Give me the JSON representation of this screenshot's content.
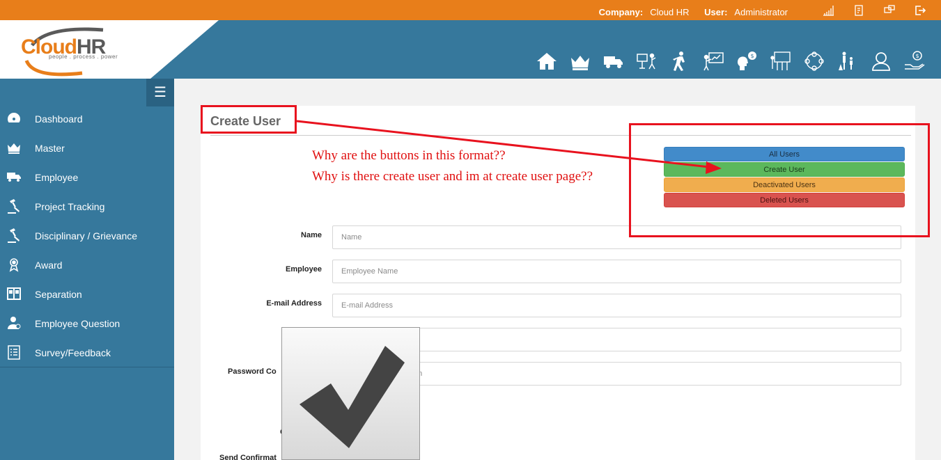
{
  "topbar": {
    "company_label": "Company:",
    "company_value": "Cloud HR",
    "user_label": "User:",
    "user_value": "Administrator",
    "icons": [
      "bar-chart-icon",
      "clipboard-icon",
      "message-icon",
      "logout-icon"
    ]
  },
  "logo": {
    "brand_a": "Cloud",
    "brand_b": "HR",
    "tagline": "people . process . power"
  },
  "module_nav": [
    "home-icon",
    "crown-icon",
    "truck-icon",
    "presentation-icon",
    "walking-icon",
    "teacher-icon",
    "money-head-icon",
    "org-board-icon",
    "people-circle-icon",
    "family-icon",
    "support-user-icon",
    "money-hand-icon"
  ],
  "sidebar": {
    "items": [
      {
        "label": "Dashboard",
        "icon": "dashboard-icon"
      },
      {
        "label": "Master",
        "icon": "crown-icon"
      },
      {
        "label": "Employee",
        "icon": "truck-icon"
      },
      {
        "label": "Project Tracking",
        "icon": "gavel-icon"
      },
      {
        "label": "Disciplinary / Grievance",
        "icon": "gavel-icon"
      },
      {
        "label": "Award",
        "icon": "award-icon"
      },
      {
        "label": "Separation",
        "icon": "door-icon"
      },
      {
        "label": "Employee Question",
        "icon": "user-question-icon"
      },
      {
        "label": "Survey/Feedback",
        "icon": "checklist-icon"
      }
    ]
  },
  "page": {
    "title": "Create User",
    "buttons": [
      {
        "label": "All Users",
        "color": "#428bca"
      },
      {
        "label": "Create User",
        "color": "#5cb85c"
      },
      {
        "label": "Deactivated Users",
        "color": "#f0ad4e"
      },
      {
        "label": "Deleted Users",
        "color": "#d9534f"
      }
    ],
    "fields": {
      "name": {
        "label": "Name",
        "placeholder": "Name",
        "value": ""
      },
      "employee": {
        "label": "Employee",
        "placeholder": "Employee Name",
        "value": ""
      },
      "email": {
        "label": "E-mail Address",
        "placeholder": "E-mail Address",
        "value": ""
      },
      "password": {
        "label": "",
        "placeholder": "",
        "value": ""
      },
      "password_confirm": {
        "label": "Password Co",
        "placeholder": "on",
        "value": ""
      }
    },
    "partial_label_1": "C",
    "partial_label_2": "Send Confirmat"
  },
  "annotations": {
    "line1": "Why are the buttons in this format??",
    "line2": "Why is there create user and im at create user page??"
  }
}
